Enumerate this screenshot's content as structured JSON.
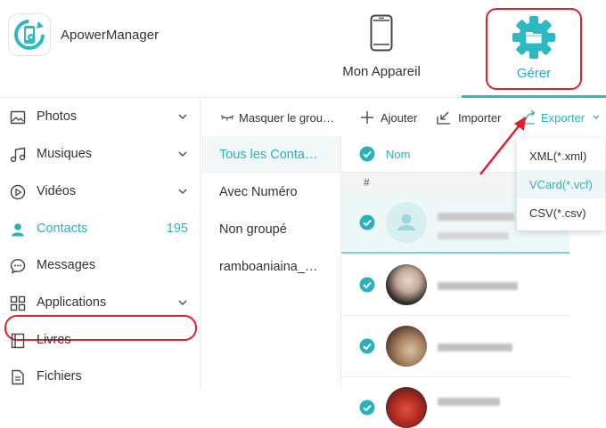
{
  "app": {
    "name": "ApowerManager"
  },
  "nav": {
    "device_label": "Mon Appareil",
    "manage_label": "Gérer"
  },
  "sidebar": {
    "items": [
      {
        "label": "Photos",
        "icon": "photo-icon",
        "has_chevron": true
      },
      {
        "label": "Musiques",
        "icon": "music-icon",
        "has_chevron": true
      },
      {
        "label": "Vidéos",
        "icon": "video-icon",
        "has_chevron": true
      },
      {
        "label": "Contacts",
        "icon": "contact-icon",
        "count": "195",
        "active": true
      },
      {
        "label": "Messages",
        "icon": "message-icon"
      },
      {
        "label": "Applications",
        "icon": "apps-icon",
        "has_chevron": true
      },
      {
        "label": "Livres",
        "icon": "book-icon"
      },
      {
        "label": "Fichiers",
        "icon": "file-icon"
      }
    ]
  },
  "toolbar": {
    "hide_groups": "Masquer le grou…",
    "add": "Ajouter",
    "import": "Importer",
    "export": "Exporter"
  },
  "groups": [
    {
      "label": "Tous les Conta…",
      "active": true
    },
    {
      "label": "Avec Numéro"
    },
    {
      "label": "Non groupé"
    },
    {
      "label": "ramboaniaina_…"
    }
  ],
  "table": {
    "name_header": "Nom",
    "index_letter": "#"
  },
  "export_menu": {
    "items": [
      "XML(*.xml)",
      "VCard(*.vcf)",
      "CSV(*.csv)"
    ],
    "hovered_index": 1
  },
  "colors": {
    "accent": "#2ab1bb",
    "highlight_outline": "#e0202a"
  }
}
